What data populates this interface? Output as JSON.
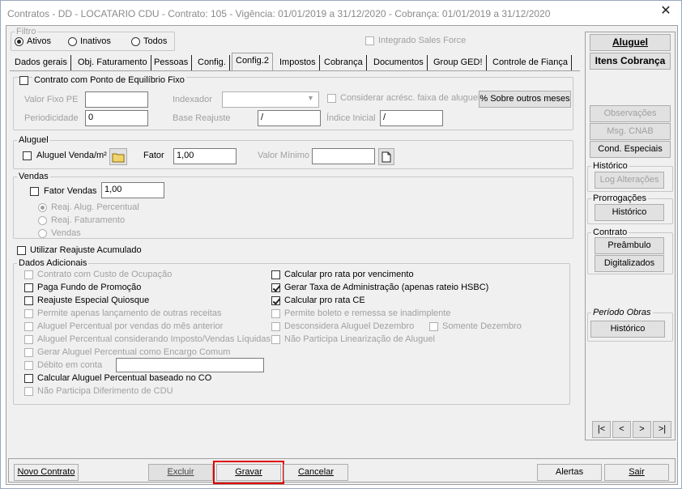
{
  "window": {
    "title": "Contratos - DD - LOCATARIO CDU - Contrato: 105 - Vigência: 01/01/2019 a 31/12/2020 - Cobrança: 01/01/2019 a 31/12/2020",
    "close": "✕"
  },
  "filter": {
    "legend": "Filtro",
    "options": [
      "Ativos",
      "Inativos",
      "Todos"
    ],
    "integrado": "Integrado Sales Force"
  },
  "tabs": [
    "Dados gerais",
    "Obj. Faturamento",
    "Pessoas",
    "Config.",
    "Config.2",
    "Impostos",
    "Cobrança",
    "Documentos",
    "Group GED!",
    "Controle de Fiança"
  ],
  "equilibrio": {
    "legend": "Contrato com Ponto de Equilíbrio Fixo",
    "valor_fixo_label": "Valor Fixo PE",
    "valor_fixo": "",
    "indexador_label": "Indexador",
    "indexador": "",
    "considerar_label": "Considerar acrésc. faixa de aluguel",
    "sobre_btn": "% Sobre outros meses",
    "periodicidade_label": "Periodicidade",
    "periodicidade": "0",
    "base_label": "Base Reajuste",
    "base": "/",
    "indice_label": "Índice Inicial",
    "indice": "/"
  },
  "aluguel": {
    "legend": "Aluguel",
    "venda_label": "Aluguel Venda/m²",
    "fator_label": "Fator",
    "fator": "1,00",
    "valor_min_label": "Valor Mínimo",
    "valor_min": ""
  },
  "vendas": {
    "legend": "Vendas",
    "fator_label": "Fator Vendas",
    "fator": "1,00",
    "radios": [
      "Reaj. Alug. Percentual",
      "Reaj. Faturamento",
      "Vendas"
    ]
  },
  "reajuste_acumulado": "Utilizar Reajuste Acumulado",
  "dados": {
    "legend": "Dados Adicionais",
    "left": [
      "Contrato com Custo de Ocupação",
      "Paga Fundo de Promoção",
      "Reajuste Especial Quiosque",
      "Permite apenas lançamento de outras receitas",
      "Aluguel Percentual por vendas do mês anterior",
      "Aluguel Percentual considerando Imposto/Vendas Líquidas",
      "Gerar Aluguel Percentual como Encargo Comum",
      "Débito em conta",
      "Calcular Aluguel Percentual baseado no CO",
      "Não Participa Diferimento de CDU"
    ],
    "right": [
      "Calcular pro rata por vencimento",
      "Gerar Taxa de Administração (apenas rateio HSBC)",
      "Calcular pro rata CE",
      "Permite boleto e remessa se inadimplente",
      "Desconsidera Aluguel Dezembro",
      "Não Participa Linearização de Aluguel"
    ],
    "somente": "Somente Dezembro"
  },
  "side": {
    "aluguel": "Aluguel",
    "itens": "Itens Cobrança",
    "observacoes": "Observações",
    "cnab": "Msg. CNAB",
    "especiais": "Cond. Especiais",
    "historico_legend": "Histórico",
    "log": "Log Alterações",
    "prorrogacoes_legend": "Prorrogações",
    "historico": "Histórico",
    "contrato_legend": "Contrato",
    "preambulo": "Preâmbulo",
    "digitalizados": "Digitalizados",
    "periodo_legend": "Período Obras",
    "periodo_historico": "Histórico",
    "nav": [
      "|<",
      "<",
      ">",
      ">|"
    ]
  },
  "footer": {
    "novo": "Novo Contrato",
    "excluir": "Excluir",
    "gravar": "Gravar",
    "cancelar": "Cancelar",
    "alertas": "Alertas",
    "sair": "Sair"
  }
}
